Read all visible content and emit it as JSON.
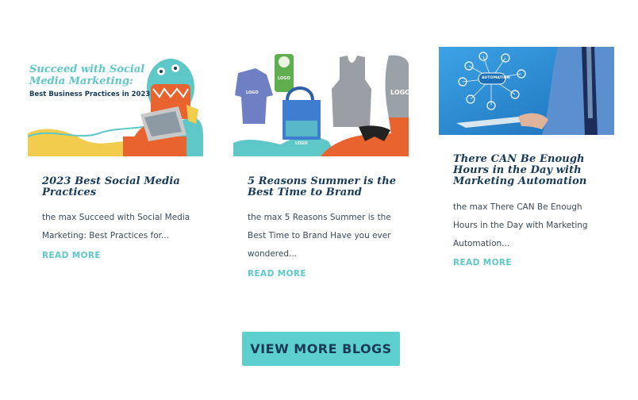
{
  "posts": [
    {
      "image_text": [
        "Succeed with Social",
        "Media Marketing:",
        "Best Business Practices in 2023"
      ],
      "title": "2023 Best Social Media Practices",
      "excerpt": "the max Succeed with Social Media Marketing: Best Practices for...",
      "read_more": "READ MORE"
    },
    {
      "image_text": [
        "LOGO",
        "LOGO",
        "LOGO",
        "LOGO"
      ],
      "title": "5 Reasons Summer is the Best Time to Brand",
      "excerpt": "the max 5 Reasons Summer is the Best Time to Brand Have you ever wondered...",
      "read_more": "READ MORE"
    },
    {
      "image_text": [
        "AUTOMATION"
      ],
      "title": "There CAN Be Enough Hours in the Day with Marketing Automation",
      "excerpt": "the max There CAN Be Enough Hours in the Day with Marketing Automation...",
      "read_more": "READ MORE"
    }
  ],
  "cta": {
    "label": "VIEW MORE BLOGS"
  },
  "colors": {
    "title": "#163a57",
    "accent": "#5ec7c8",
    "button": "#5ecfcf"
  }
}
